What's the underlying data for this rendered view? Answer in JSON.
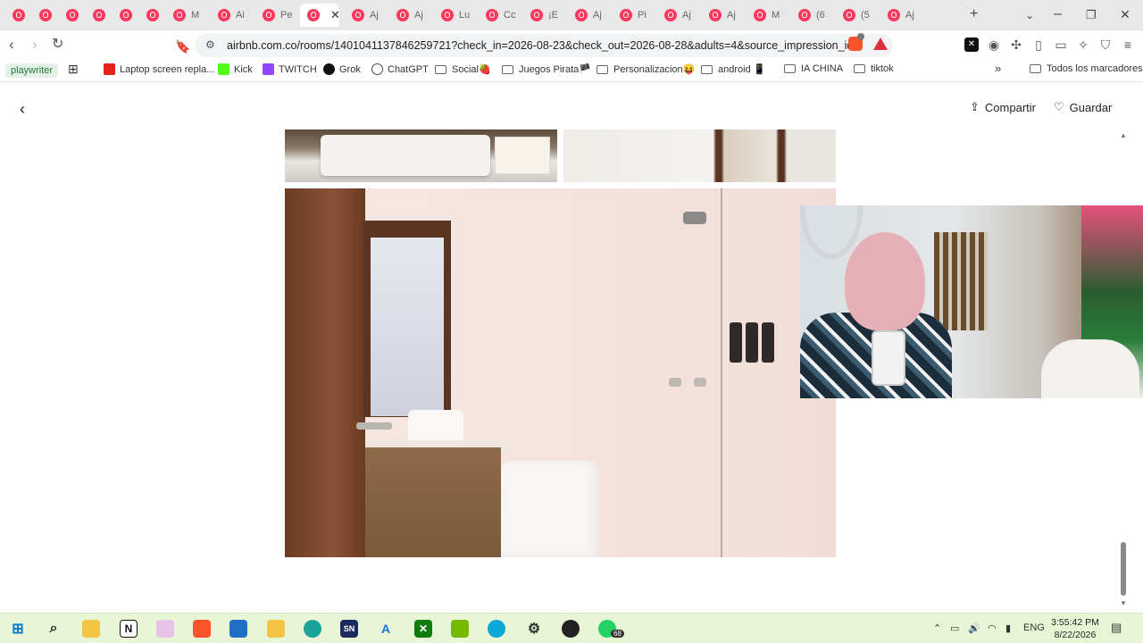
{
  "browser": {
    "tabs": [
      {
        "label": ""
      },
      {
        "label": ""
      },
      {
        "label": ""
      },
      {
        "label": ""
      },
      {
        "label": ""
      },
      {
        "label": ""
      },
      {
        "label": "M"
      },
      {
        "label": "Ai"
      },
      {
        "label": "Pe"
      },
      {
        "label": "",
        "active": true
      },
      {
        "label": "Aj"
      },
      {
        "label": "Aj"
      },
      {
        "label": "Lu"
      },
      {
        "label": "Cc"
      },
      {
        "label": "¡E"
      },
      {
        "label": "Aj"
      },
      {
        "label": "Pi"
      },
      {
        "label": "Aj"
      },
      {
        "label": "Aj"
      },
      {
        "label": "M"
      },
      {
        "label": "(6"
      },
      {
        "label": "(5"
      },
      {
        "label": "Aj"
      }
    ],
    "new_tab_label": "+",
    "close_tab_label": "✕",
    "url": "airbnb.com.co/rooms/1401041137846259721?check_in=2026-08-23&check_out=2026-08-28&adults=4&source_impression_id=p..."
  },
  "bookmarks": {
    "items": [
      {
        "label": "playwriter",
        "kind": "pill"
      },
      {
        "label": "Laptop screen repla...",
        "kind": "youtube"
      },
      {
        "label": "Kick",
        "kind": "kick"
      },
      {
        "label": "TWITCH",
        "kind": "twitch"
      },
      {
        "label": "Grok",
        "kind": "grok"
      },
      {
        "label": "ChatGPT",
        "kind": "chatgpt"
      },
      {
        "label": "Social🍓",
        "kind": "folder"
      },
      {
        "label": "Juegos Pirata🏴",
        "kind": "folder"
      },
      {
        "label": "Personalizacion😝",
        "kind": "folder"
      },
      {
        "label": "android 📱",
        "kind": "folder"
      },
      {
        "label": "IA CHINA",
        "kind": "folder"
      },
      {
        "label": "tiktok",
        "kind": "folder"
      }
    ],
    "overflow": "»",
    "all_bookmarks": "Todos los marcadores"
  },
  "page": {
    "share_label": "Compartir",
    "save_label": "Guardar"
  },
  "taskbar": {
    "time": "3:55:42 PM",
    "date": "8/22/2026",
    "lang": "ENG",
    "notification_badge": "68"
  },
  "colors": {
    "airbnb": "#ff385c",
    "taskbar": "#e9f6d6"
  }
}
